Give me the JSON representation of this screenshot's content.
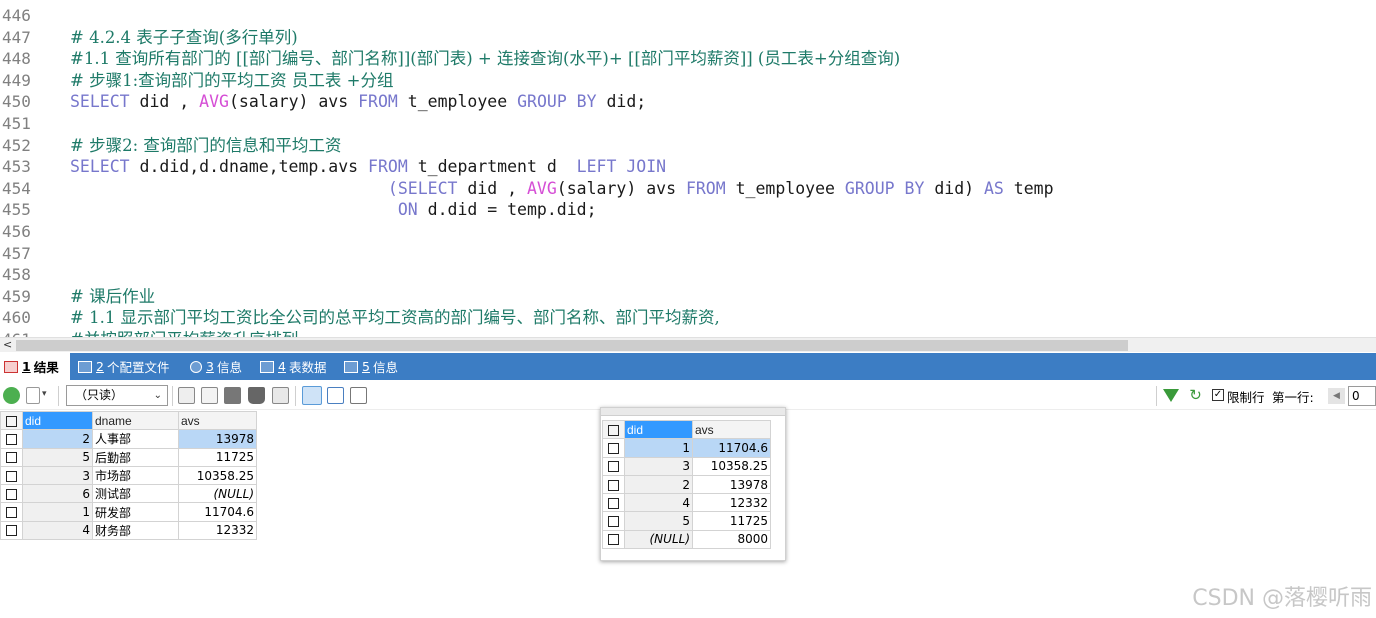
{
  "editor": {
    "lines": [
      {
        "n": "446",
        "tokens": []
      },
      {
        "n": "447",
        "tokens": [
          {
            "t": "cm",
            "v": "# 4.2.4 表子子查询(多行单列)"
          }
        ]
      },
      {
        "n": "448",
        "tokens": [
          {
            "t": "cm",
            "v": "#1.1 查询所有部门的 [[部门编号、部门名称]](部门表) + 连接查询(水平)+ [[部门平均薪资]] (员工表+分组查询)"
          }
        ]
      },
      {
        "n": "449",
        "tokens": [
          {
            "t": "cm",
            "v": "# 步骤1:查询部门的平均工资 员工表 +分组"
          }
        ]
      },
      {
        "n": "450",
        "tokens": [
          {
            "t": "kw",
            "v": "SELECT"
          },
          {
            "t": "tx",
            "v": " did , "
          },
          {
            "t": "fn",
            "v": "AVG"
          },
          {
            "t": "tx",
            "v": "(salary) avs "
          },
          {
            "t": "kw",
            "v": "FROM"
          },
          {
            "t": "tx",
            "v": " t_employee "
          },
          {
            "t": "kw",
            "v": "GROUP BY"
          },
          {
            "t": "tx",
            "v": " did;"
          }
        ]
      },
      {
        "n": "451",
        "tokens": []
      },
      {
        "n": "452",
        "tokens": [
          {
            "t": "cm",
            "v": "# 步骤2: 查询部门的信息和平均工资"
          }
        ]
      },
      {
        "n": "453",
        "tokens": [
          {
            "t": "kw",
            "v": "SELECT"
          },
          {
            "t": "tx",
            "v": " d.did,d.dname,temp.avs "
          },
          {
            "t": "kw",
            "v": "FROM"
          },
          {
            "t": "tx",
            "v": " t_department d  "
          },
          {
            "t": "kw",
            "v": "LEFT JOIN"
          }
        ]
      },
      {
        "n": "454",
        "tokens": [
          {
            "t": "tx",
            "v": "                                "
          },
          {
            "t": "kw",
            "v": "("
          },
          {
            "t": "kw",
            "v": "SELECT"
          },
          {
            "t": "tx",
            "v": " did , "
          },
          {
            "t": "fn",
            "v": "AVG"
          },
          {
            "t": "tx",
            "v": "(salary) avs "
          },
          {
            "t": "kw",
            "v": "FROM"
          },
          {
            "t": "tx",
            "v": " t_employee "
          },
          {
            "t": "kw",
            "v": "GROUP BY"
          },
          {
            "t": "tx",
            "v": " did) "
          },
          {
            "t": "kw",
            "v": "AS"
          },
          {
            "t": "tx",
            "v": " temp"
          }
        ]
      },
      {
        "n": "455",
        "tokens": [
          {
            "t": "tx",
            "v": "                                 "
          },
          {
            "t": "kw",
            "v": "ON"
          },
          {
            "t": "tx",
            "v": " d.did = temp.did;"
          }
        ]
      },
      {
        "n": "456",
        "tokens": []
      },
      {
        "n": "457",
        "tokens": []
      },
      {
        "n": "458",
        "tokens": []
      },
      {
        "n": "459",
        "tokens": [
          {
            "t": "cm",
            "v": "# 课后作业"
          }
        ]
      },
      {
        "n": "460",
        "tokens": [
          {
            "t": "cm",
            "v": "# 1.1 显示部门平均工资比全公司的总平均工资高的部门编号、部门名称、部门平均薪资,"
          }
        ]
      },
      {
        "n": "461",
        "tokens": [
          {
            "t": "cm",
            "v": "#并按照部门平均薪资升序排列"
          }
        ]
      }
    ]
  },
  "tabs": [
    {
      "num": "1",
      "label": "结果",
      "active": true
    },
    {
      "num": "2",
      "label": "个配置文件",
      "active": false
    },
    {
      "num": "3",
      "label": "信息",
      "active": false
    },
    {
      "num": "4",
      "label": "表数据",
      "active": false
    },
    {
      "num": "5",
      "label": "信息",
      "active": false
    }
  ],
  "toolbar": {
    "readonly_label": "（只读）",
    "limit_label": "限制行",
    "first_row_label": "第一行:",
    "first_row_value": "0"
  },
  "grid1": {
    "columns": [
      "did",
      "dname",
      "avs"
    ],
    "rows": [
      {
        "did": "2",
        "dname": "人事部",
        "avs": "13978"
      },
      {
        "did": "5",
        "dname": "后勤部",
        "avs": "11725"
      },
      {
        "did": "3",
        "dname": "市场部",
        "avs": "10358.25"
      },
      {
        "did": "6",
        "dname": "测试部",
        "avs": "(NULL)"
      },
      {
        "did": "1",
        "dname": "研发部",
        "avs": "11704.6"
      },
      {
        "did": "4",
        "dname": "财务部",
        "avs": "12332"
      }
    ]
  },
  "grid2": {
    "columns": [
      "did",
      "avs"
    ],
    "rows": [
      {
        "did": "1",
        "avs": "11704.6"
      },
      {
        "did": "3",
        "avs": "10358.25"
      },
      {
        "did": "2",
        "avs": "13978"
      },
      {
        "did": "4",
        "avs": "12332"
      },
      {
        "did": "5",
        "avs": "11725"
      },
      {
        "did": "(NULL)",
        "avs": "8000"
      }
    ]
  },
  "watermark": "CSDN @落樱听雨"
}
